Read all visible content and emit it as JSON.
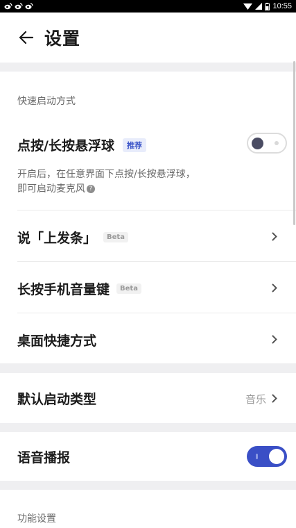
{
  "status_bar": {
    "time": "10:55"
  },
  "header": {
    "title": "设置"
  },
  "quick_launch": {
    "section_title": "快速启动方式",
    "floating_ball": {
      "label": "点按/长按悬浮球",
      "badge": "推荐",
      "enabled": false,
      "description_line1": "开启后，在任意界面下点按/长按悬浮球，",
      "description_line2": "即可启动麦克风"
    },
    "voice_command": {
      "label": "说「上发条」",
      "badge": "Beta"
    },
    "volume_key": {
      "label": "长按手机音量键",
      "badge": "Beta"
    },
    "desktop_shortcut": {
      "label": "桌面快捷方式"
    }
  },
  "default_launch": {
    "label": "默认启动类型",
    "value": "音乐"
  },
  "voice_broadcast": {
    "label": "语音播报",
    "enabled": true
  },
  "function_settings": {
    "section_title": "功能设置"
  },
  "colors": {
    "accent": "#3a4fc6",
    "badge_bg": "#e8ecfb",
    "page_bg": "#efeff1"
  }
}
